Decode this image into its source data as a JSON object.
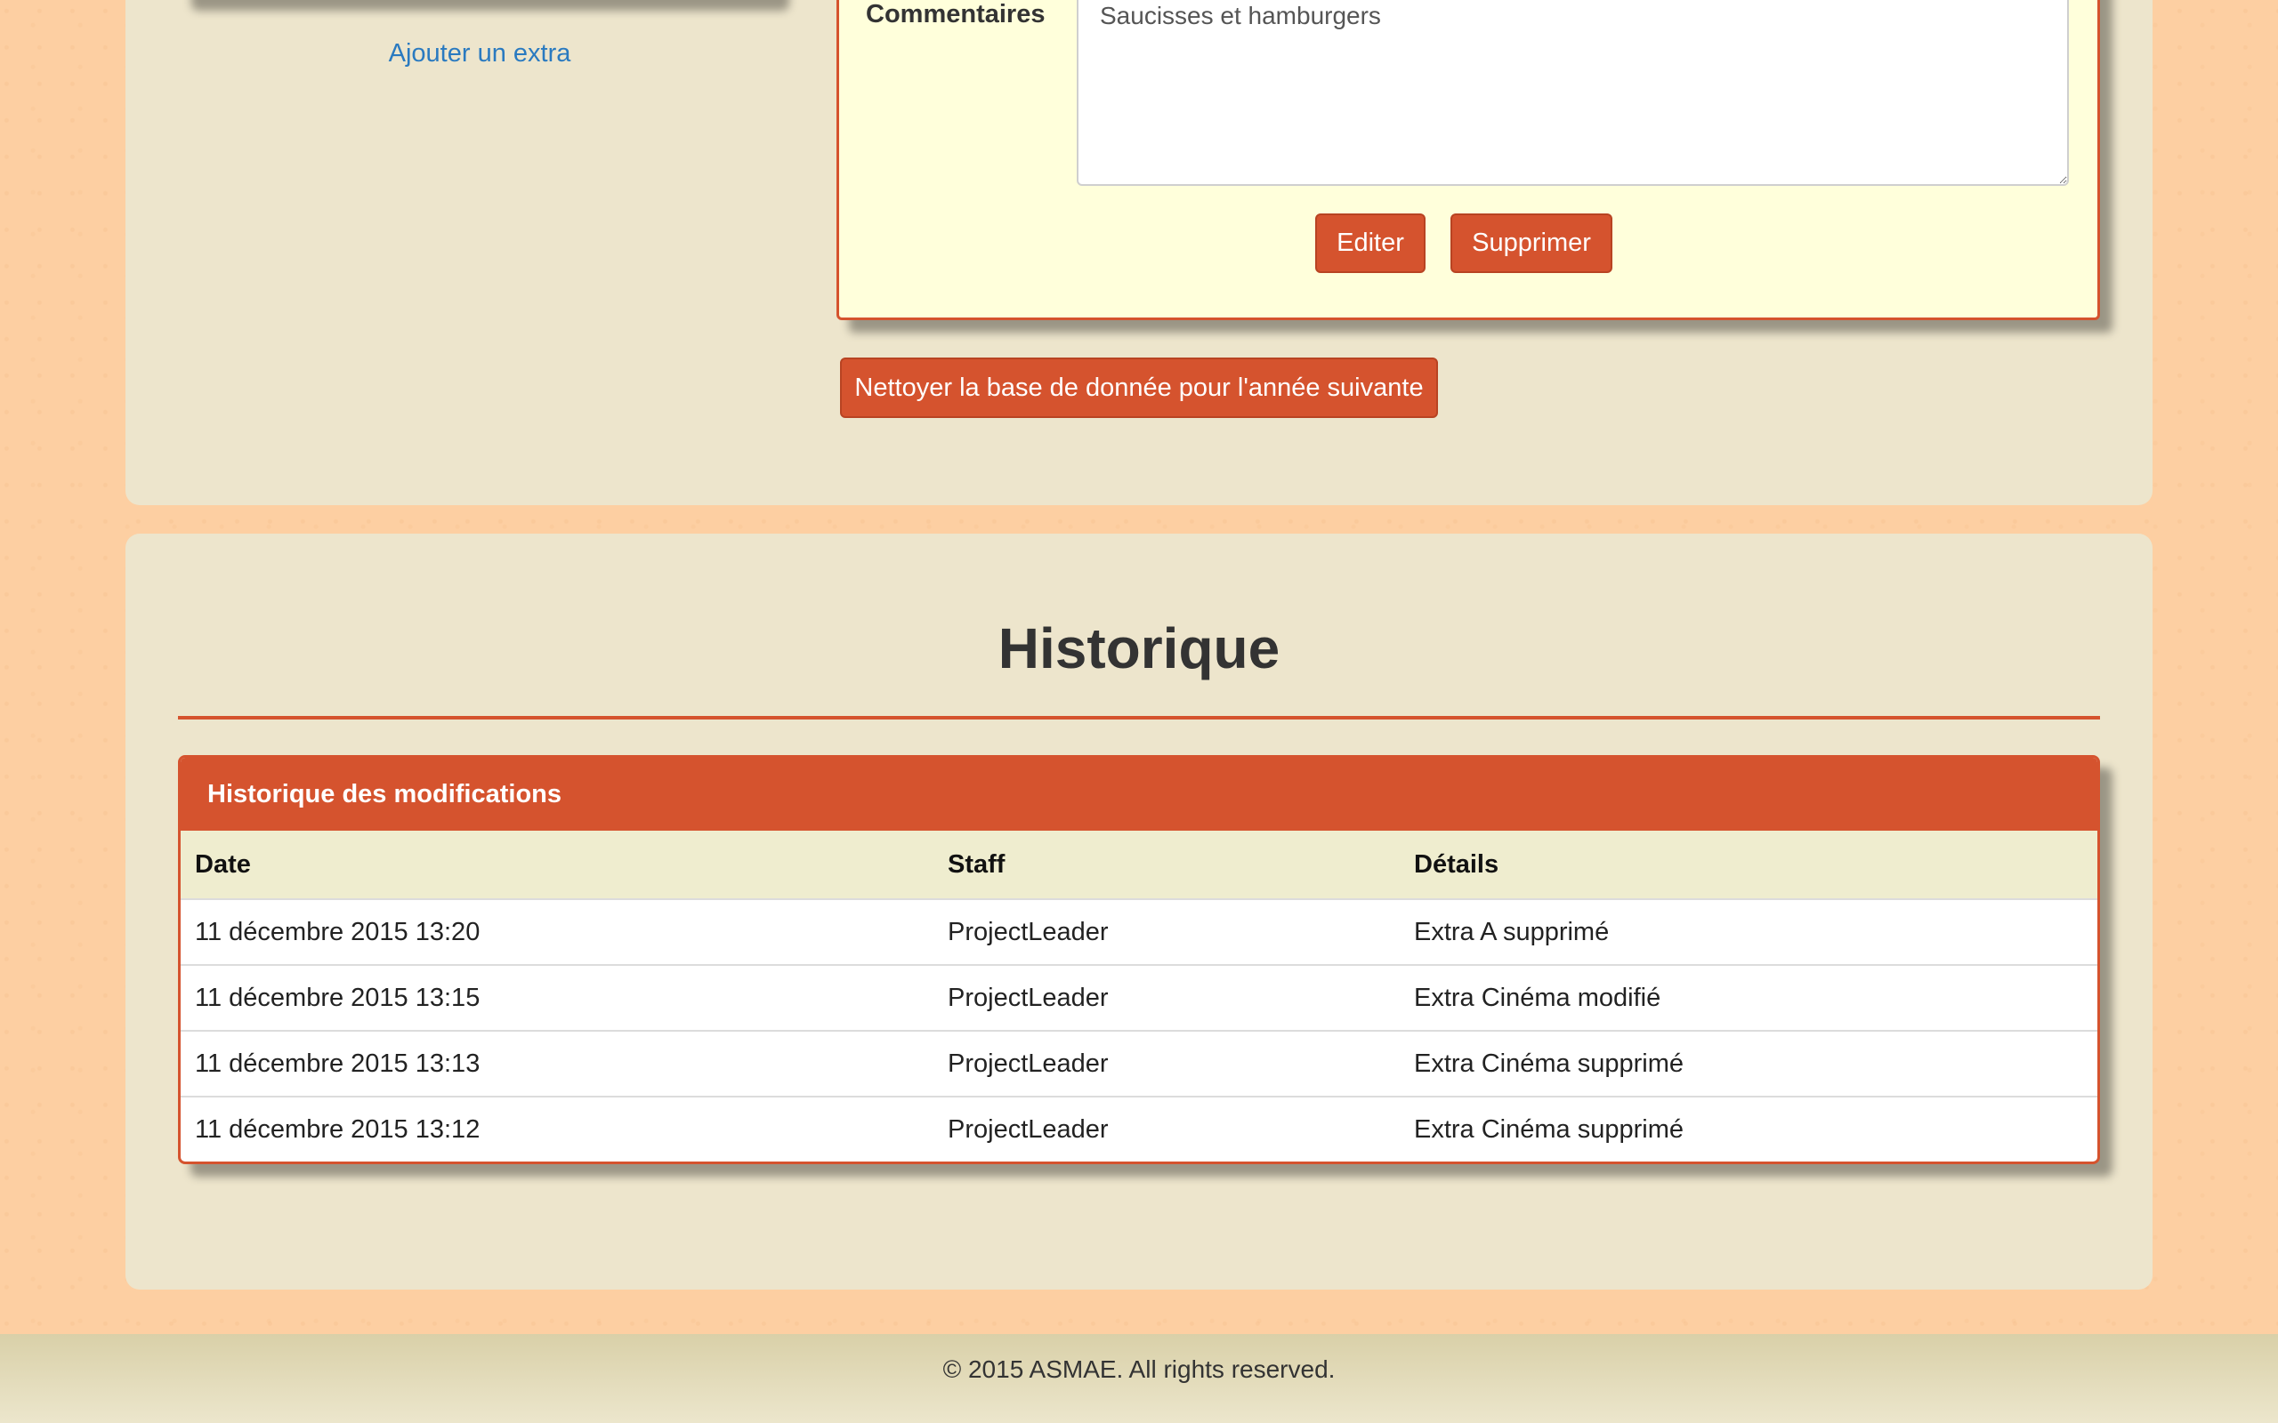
{
  "sidebar": {
    "add_extra_link": "Ajouter un extra"
  },
  "detail": {
    "comments_label": "Commentaires",
    "comments_value": "Saucisses et hamburgers",
    "edit_button": "Editer",
    "delete_button": "Supprimer"
  },
  "actions": {
    "clean_db_button": "Nettoyer la base de donnée pour l'année suivante"
  },
  "history": {
    "title": "Historique",
    "panel_title": "Historique des modifications",
    "columns": [
      "Date",
      "Staff",
      "Détails"
    ],
    "rows": [
      {
        "date": "11 décembre 2015 13:20",
        "staff": "ProjectLeader",
        "details": "Extra A supprimé"
      },
      {
        "date": "11 décembre 2015 13:15",
        "staff": "ProjectLeader",
        "details": "Extra Cinéma modifié"
      },
      {
        "date": "11 décembre 2015 13:13",
        "staff": "ProjectLeader",
        "details": "Extra Cinéma supprimé"
      },
      {
        "date": "11 décembre 2015 13:12",
        "staff": "ProjectLeader",
        "details": "Extra Cinéma supprimé"
      }
    ]
  },
  "footer": {
    "copyright": "© 2015 ASMAE. All rights reserved."
  },
  "colors": {
    "accent": "#d5532e",
    "page_background": "#fdcfa2",
    "card_background": "#ede5cc",
    "panel_background": "#ffffdb",
    "link": "#2a7ac0"
  }
}
